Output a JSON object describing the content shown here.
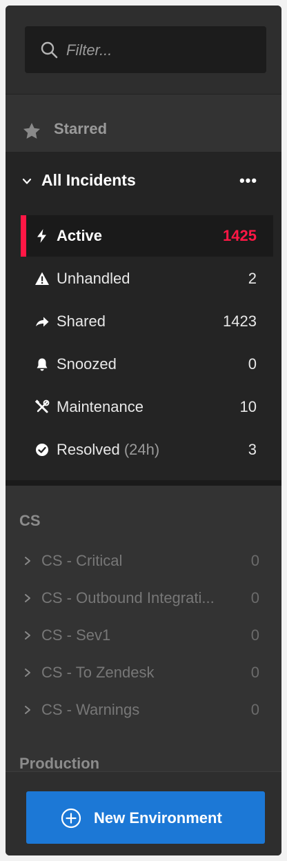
{
  "search": {
    "placeholder": "Filter...",
    "value": ""
  },
  "starred": {
    "label": "Starred",
    "icon": "star-icon"
  },
  "all_incidents": {
    "title": "All Incidents",
    "more_label": "•••",
    "items": [
      {
        "label": "Active",
        "count": "1425",
        "icon": "bolt-icon",
        "active": true
      },
      {
        "label": "Unhandled",
        "count": "2",
        "icon": "warning-icon"
      },
      {
        "label": "Shared",
        "count": "1423",
        "icon": "share-arrow-icon"
      },
      {
        "label": "Snoozed",
        "count": "0",
        "icon": "bell-icon"
      },
      {
        "label": "Maintenance",
        "count": "10",
        "icon": "tools-icon"
      },
      {
        "label": "Resolved",
        "sublabel": "(24h)",
        "count": "3",
        "icon": "check-circle-icon"
      }
    ]
  },
  "groups": [
    {
      "title": "CS",
      "items": [
        {
          "label": "CS - Critical",
          "count": "0"
        },
        {
          "label": "CS - Outbound Integrati...",
          "count": "0"
        },
        {
          "label": "CS - Sev1",
          "count": "0"
        },
        {
          "label": "CS - To Zendesk",
          "count": "0"
        },
        {
          "label": "CS - Warnings",
          "count": "0"
        }
      ]
    },
    {
      "title": "Production",
      "items": []
    }
  ],
  "footer": {
    "new_environment_label": "New Environment"
  },
  "colors": {
    "accent_red": "#ff1745",
    "button_blue": "#1c78d6",
    "panel_dark": "#242424",
    "background": "#333333"
  }
}
